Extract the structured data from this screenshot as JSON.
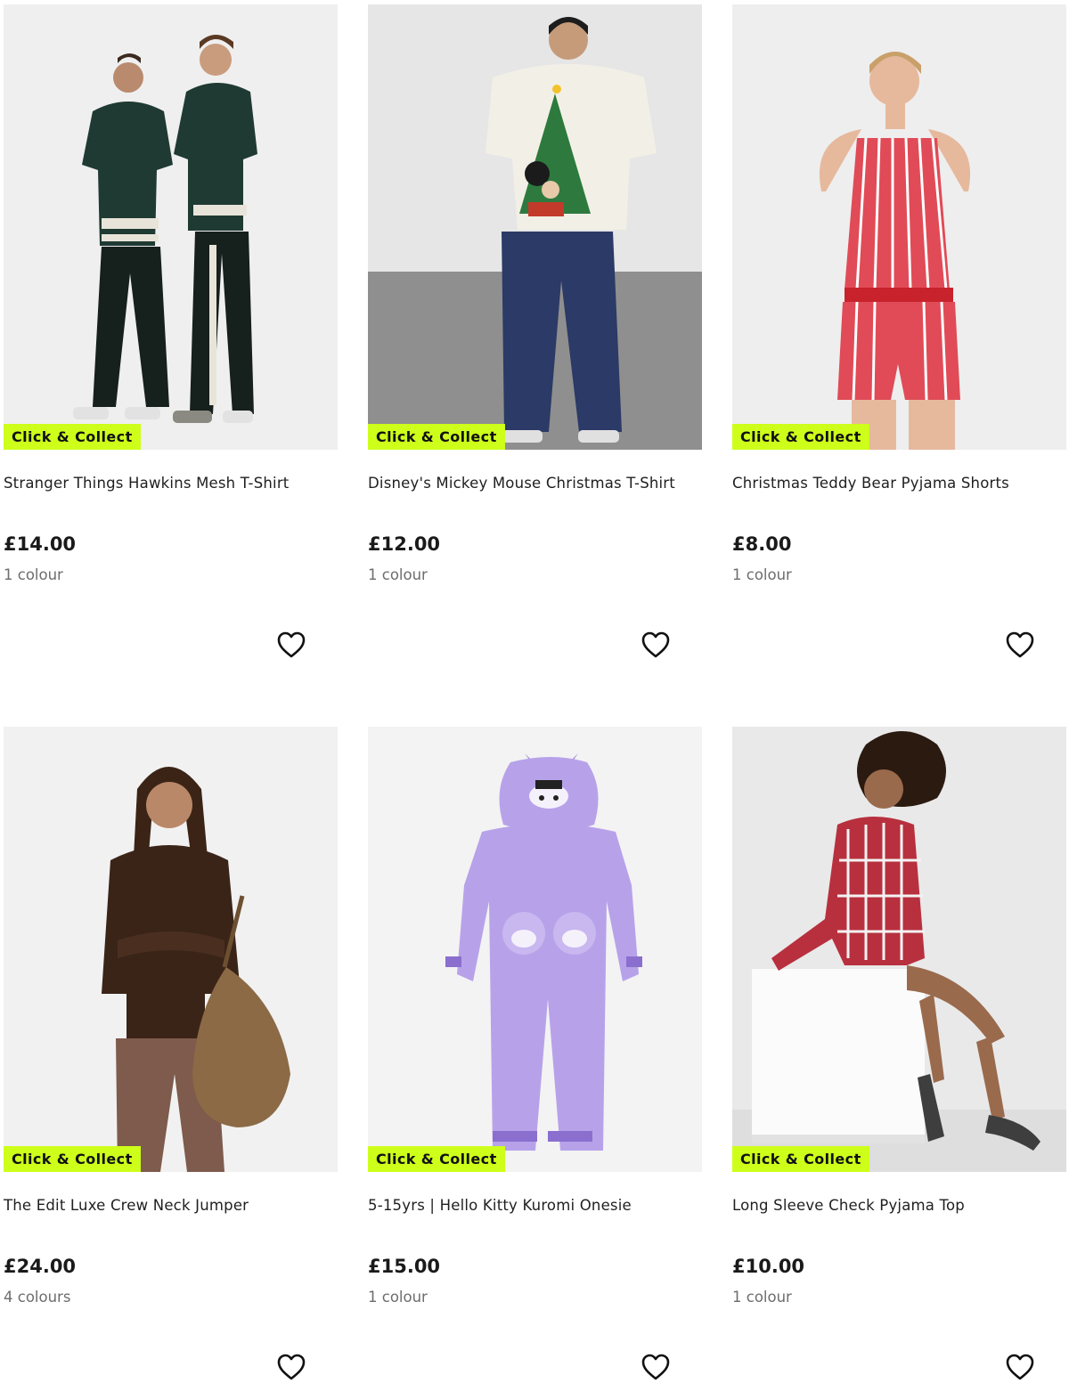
{
  "products": [
    {
      "title": "Stranger Things Hawkins Mesh T-Shirt",
      "price": "£14.00",
      "colours": "1 colour",
      "badge": "Click & Collect",
      "image_icon": "two-models-varsity-tees"
    },
    {
      "title": "Disney's Mickey Mouse Christmas T-Shirt",
      "price": "£12.00",
      "colours": "1 colour",
      "badge": "Click & Collect",
      "image_icon": "model-christmas-tree-tee"
    },
    {
      "title": "Christmas Teddy Bear Pyjama Shorts",
      "price": "£8.00",
      "colours": "1 colour",
      "badge": "Click & Collect",
      "image_icon": "model-striped-pyjamas"
    },
    {
      "title": "The Edit Luxe Crew Neck Jumper",
      "price": "£24.00",
      "colours": "4 colours",
      "badge": "Click & Collect",
      "image_icon": "model-brown-jumper"
    },
    {
      "title": "5-15yrs | Hello Kitty Kuromi Onesie",
      "price": "£15.00",
      "colours": "1 colour",
      "badge": "Click & Collect",
      "image_icon": "purple-onesie"
    },
    {
      "title": "Long Sleeve Check Pyjama Top",
      "price": "£10.00",
      "colours": "1 colour",
      "badge": "Click & Collect",
      "image_icon": "model-check-pyjama-top"
    }
  ],
  "colors": {
    "badge_bg": "#cdff1a",
    "image_bg": "#f1f1f1",
    "price_text": "#1a1a1a",
    "secondary_text": "#6d6d6d"
  },
  "icons": {
    "wishlist": "heart-outline-icon"
  }
}
